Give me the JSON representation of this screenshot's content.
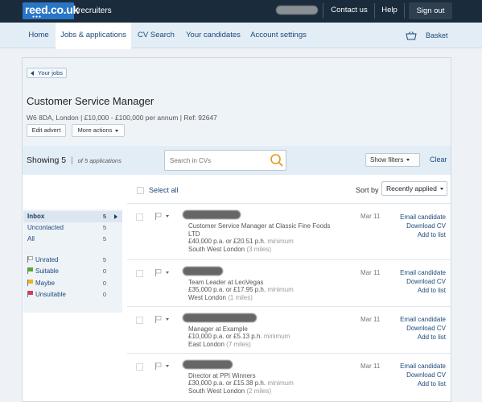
{
  "topbar": {
    "logo_text": "reed.co.uk",
    "logo_sub": "recruiters",
    "contact_us": "Contact us",
    "help": "Help",
    "sign_out": "Sign out"
  },
  "nav": {
    "items": [
      "Home",
      "Jobs & applications",
      "CV Search",
      "Your candidates",
      "Account settings"
    ],
    "active": "Jobs & applications",
    "basket": "Basket"
  },
  "job": {
    "back_label": "Your jobs",
    "title": "Customer Service Manager",
    "meta": "W6 8DA, London  |  £10,000 - £100,000 per annum | Ref: 92647",
    "edit_advert": "Edit advert",
    "more_actions": "More actions"
  },
  "filter_bar": {
    "showing": "Showing 5",
    "showing_sub": "of 5 applications",
    "search_placeholder": "Search in CVs",
    "show_filters": "Show filters",
    "clear": "Clear"
  },
  "list_header": {
    "select_all": "Select all",
    "sort_label": "Sort by",
    "sort_value": "Recently applied"
  },
  "sidebar": {
    "groups": [
      {
        "label": "Inbox",
        "count": "5"
      },
      {
        "label": "Uncontacted",
        "count": "5"
      },
      {
        "label": "All",
        "count": "5"
      }
    ],
    "flags": [
      {
        "label": "Unrated",
        "count": "5",
        "color": "#ffffff"
      },
      {
        "label": "Suitable",
        "count": "0",
        "color": "#5aa630"
      },
      {
        "label": "Maybe",
        "count": "0",
        "color": "#f2b21b"
      },
      {
        "label": "Unsuitable",
        "count": "0",
        "color": "#d63b5b"
      }
    ]
  },
  "applications": [
    {
      "role": "Customer Service Manager at Classic Fine Foods LTD",
      "pay": "£40,000 p.a. or £20.51 p.h.",
      "pay_note": "minimum",
      "location": "South West London",
      "distance": "(3 miles)",
      "date": "Mar 11"
    },
    {
      "role": "Team Leader at LeoVegas",
      "pay": "£35,000 p.a. or £17.95 p.h.",
      "pay_note": "minimum",
      "location": "West London",
      "distance": "(1 miles)",
      "date": "Mar 11"
    },
    {
      "role": "Manager at Example",
      "pay": "£10,000 p.a. or £5.13 p.h.",
      "pay_note": "minimum",
      "location": "East London",
      "distance": "(7 miles)",
      "date": "Mar 11"
    },
    {
      "role": "Director at PPI Winners",
      "pay": "£30,000 p.a. or £15.38 p.h.",
      "pay_note": "minimum",
      "location": "South West London",
      "distance": "(2 miles)",
      "date": "Mar 11"
    }
  ],
  "row_actions": {
    "email": "Email candidate",
    "download": "Download CV",
    "add": "Add to list"
  },
  "colors": {
    "topbar": "#1a2c3c",
    "logo": "#2a76c6",
    "nav_bg": "#e3edf6",
    "link": "#1c4a7a"
  }
}
